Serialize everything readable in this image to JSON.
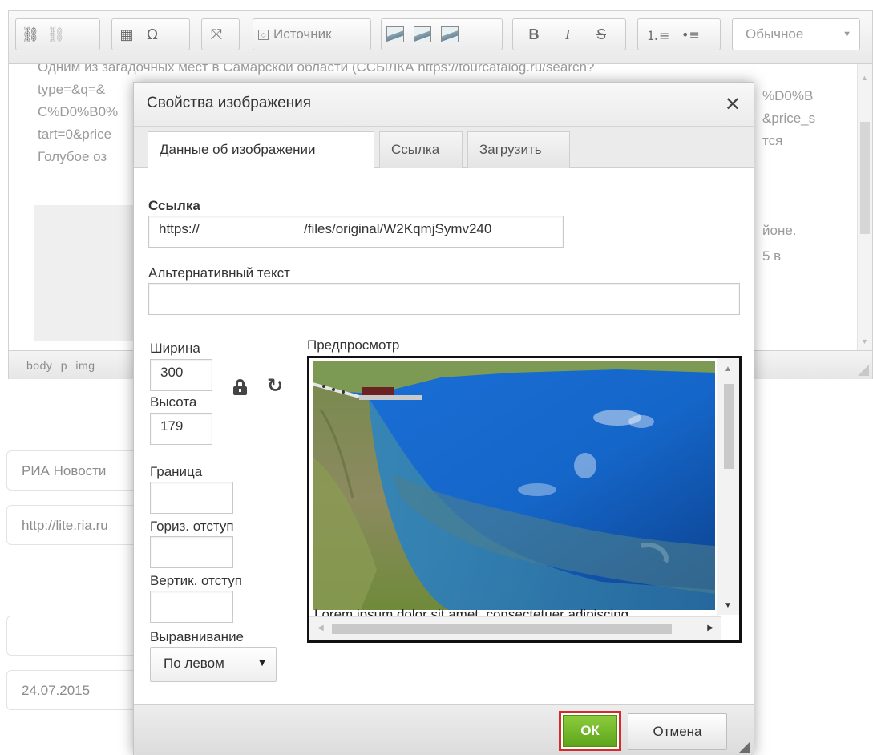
{
  "toolbar": {
    "source_label": "Источник",
    "format_value": "Обычное",
    "icons": [
      "link-icon",
      "unlink-icon",
      "table-icon",
      "omega-icon",
      "maximize-icon",
      "source-icon",
      "image-icon",
      "image-icon",
      "image-icon",
      "bold-icon",
      "italic-icon",
      "strike-icon",
      "numbered-list-icon",
      "bulleted-list-icon"
    ],
    "bold": "B",
    "italic": "I",
    "strike": "S",
    "omega": "Ω"
  },
  "editor": {
    "lines": [
      "Одним из загадочных мест в Самарской области (ССЫЛКА https://tourcatalog.ru/search?",
      "type=&q=&",
      "C%D0%B0%",
      "tart=0&price",
      "Голубое оз"
    ],
    "right_lines": [
      "%D0%B",
      "&price_s",
      "тся"
    ],
    "right_lines2": [
      "йоне.",
      "5 в"
    ]
  },
  "statusbar": {
    "path": "body p img"
  },
  "background_fields": {
    "source_name": "РИА Новости",
    "source_url": "http://lite.ria.ru",
    "date": "24.07.2015"
  },
  "dialog": {
    "title": "Свойства изображения",
    "tabs": [
      "Данные об изображении",
      "Ссылка",
      "Загрузить"
    ],
    "url_label": "Ссылка",
    "url_prefix": "https://",
    "url_suffix": "/files/original/W2KqmjSymv240",
    "alt_label": "Альтернативный текст",
    "alt_value": "",
    "width_label": "Ширина",
    "width_value": "300",
    "height_label": "Высота",
    "height_value": "179",
    "border_label": "Граница",
    "border_value": "",
    "hspace_label": "Гориз. отступ",
    "hspace_value": "",
    "vspace_label": "Вертик. отступ",
    "vspace_value": "",
    "align_label": "Выравнивание",
    "align_value": "По левом",
    "preview_label": "Предпросмотр",
    "preview_lorem": "Lorem ipsum dolor sit amet, consectetuer adipiscing",
    "ok_label": "ОК",
    "cancel_label": "Отмена"
  },
  "colors": {
    "ok_green": "#6bb323",
    "highlight_red": "#d62a2a"
  }
}
